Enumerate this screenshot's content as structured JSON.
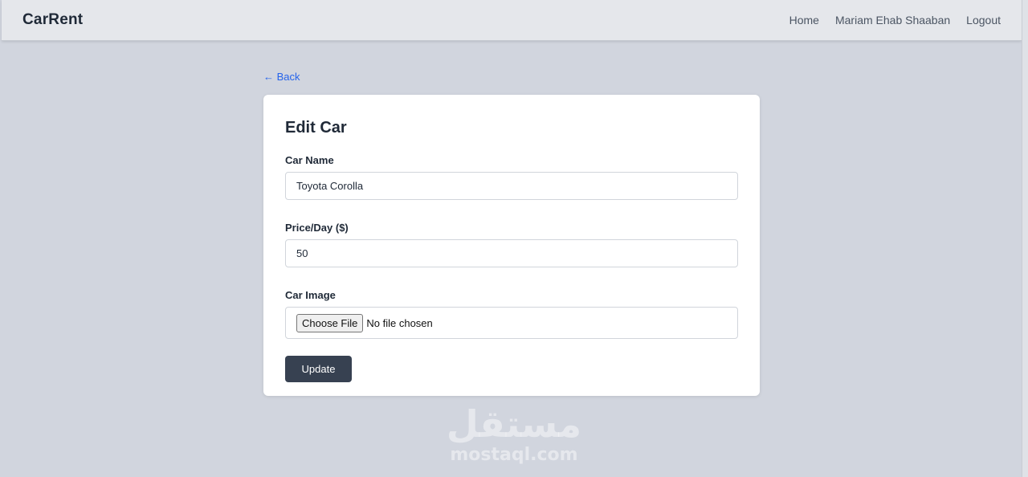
{
  "navbar": {
    "brand": "CarRent",
    "links": [
      "Home",
      "Mariam Ehab Shaaban",
      "Logout"
    ]
  },
  "back_link": "← Back",
  "form": {
    "title": "Edit Car",
    "car_name": {
      "label": "Car Name",
      "value": "Toyota Corolla"
    },
    "price": {
      "label": "Price/Day ($)",
      "value": "50"
    },
    "image": {
      "label": "Car Image",
      "button_label": "Choose File",
      "status": "No file chosen"
    },
    "submit_label": "Update"
  },
  "watermark": {
    "arabic": "مستقل",
    "latin": "mostaql.com"
  },
  "colors": {
    "page_bg": "#d1d5de",
    "navbar_bg": "#e5e7eb",
    "link": "#2563eb",
    "button_bg": "#374151"
  }
}
